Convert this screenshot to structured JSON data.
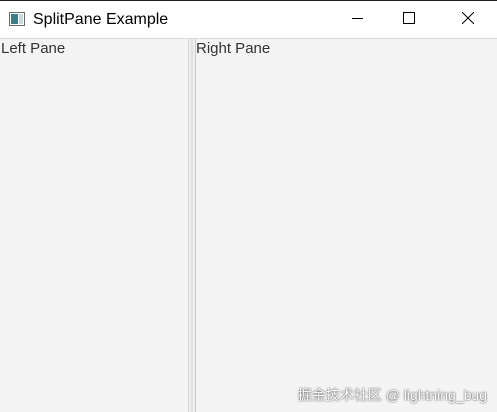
{
  "window": {
    "title": "SplitPane Example",
    "icon": "java-app-icon",
    "controls": {
      "minimize": "minimize-icon",
      "maximize": "maximize-icon",
      "close": "close-icon"
    }
  },
  "splitpane": {
    "left_label": "Left Pane",
    "right_label": "Right Pane",
    "divider_icon": "divider-handle"
  },
  "watermark": "掘金技术社区 @ lightning_bug",
  "colors": {
    "titlebar_bg": "#ffffff",
    "pane_bg": "#f4f4f4",
    "text": "#333333"
  }
}
